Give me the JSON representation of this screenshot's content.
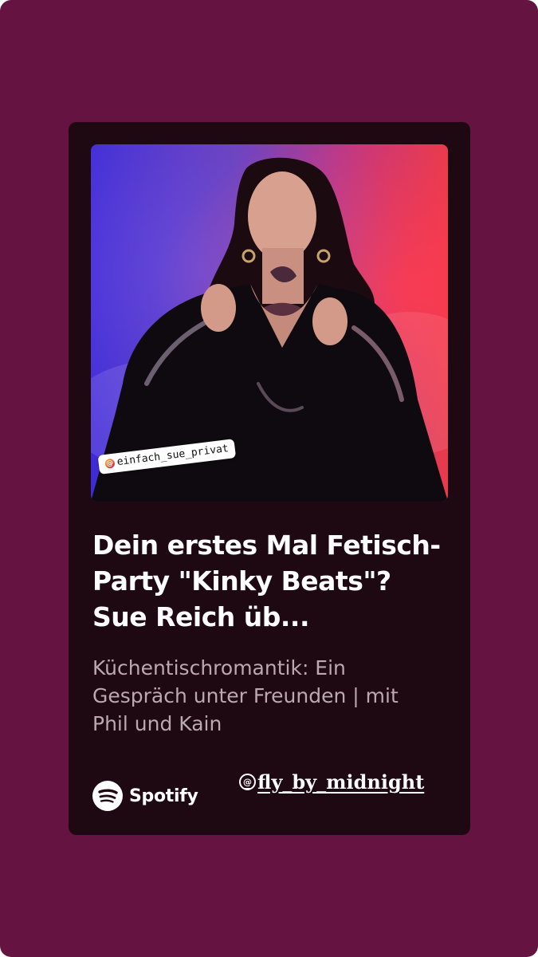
{
  "story": {
    "background_color": "#651340"
  },
  "card": {
    "cover_tag": "einfach_sue_privat",
    "cover_tag_icon": "at-sign-icon",
    "episode_title": "Dein erstes Mal Fetisch-Party \"Kinky Beats\"? Sue Reich üb...",
    "show_name": "Küchentischromantik: Ein Gespräch unter Freunden | mit Phil und Kain",
    "brand": {
      "icon": "spotify-icon",
      "name": "Spotify"
    }
  },
  "mention": {
    "text": "fly_by_midnight",
    "icon": "at-sign-icon"
  }
}
